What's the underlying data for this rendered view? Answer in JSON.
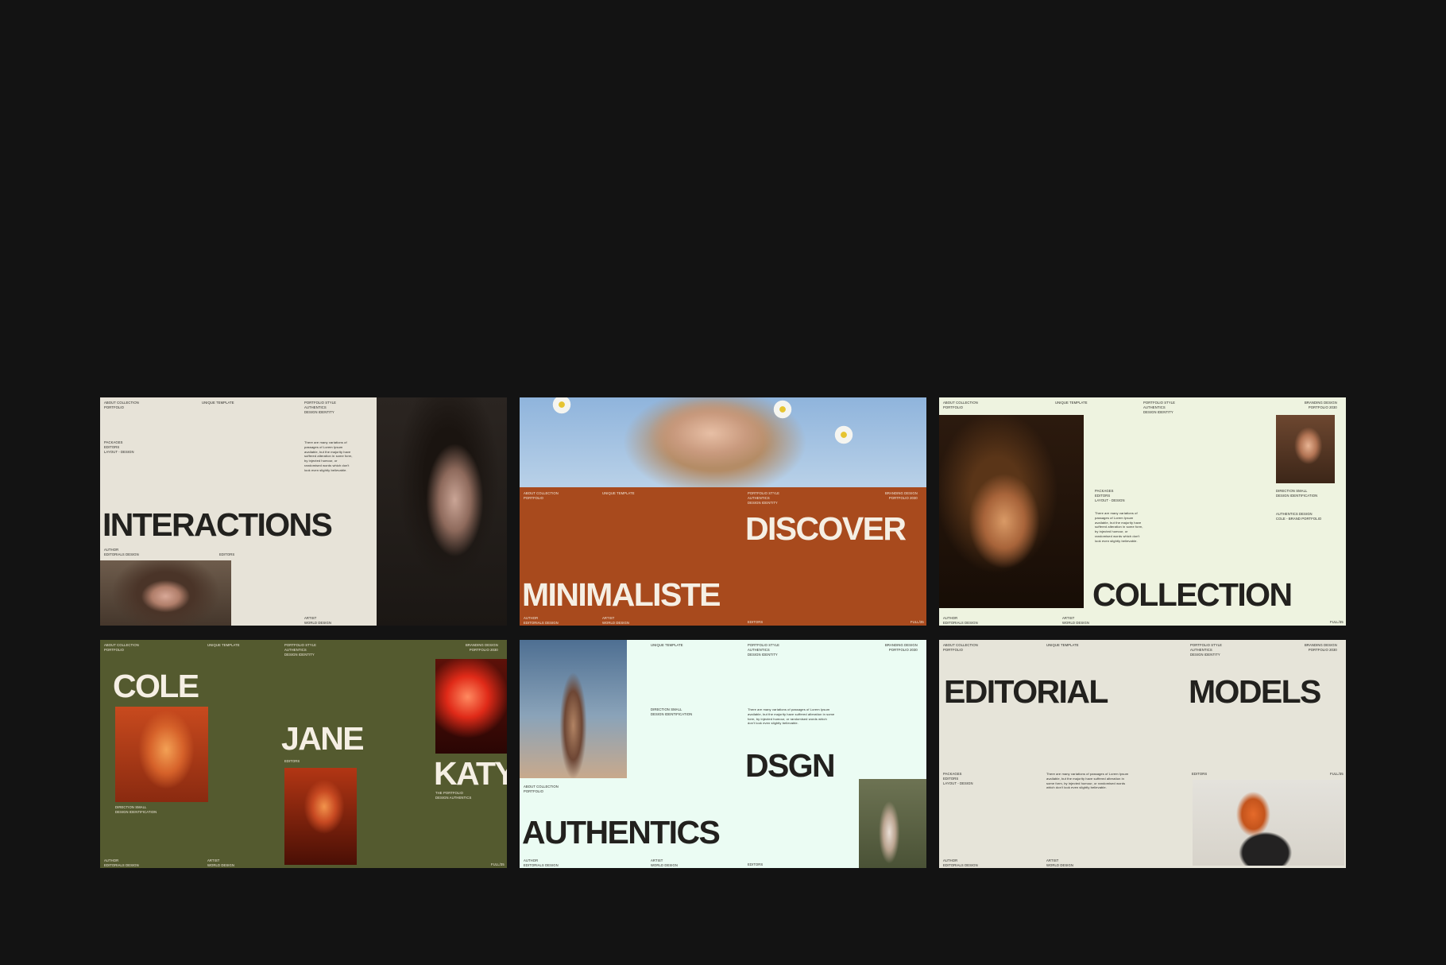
{
  "slides": [
    {
      "headline": "INTERACTIONS",
      "top": [
        "ABOUT COLLECTION\nPORTFOLIO",
        "UNIQUE TEMPLATE",
        "PORTFOLIO STYLE\nAUTHENTICS\nDESIGN IDENTITY"
      ],
      "side": "PACKAGES\nEDITORS\nLAYOUT - DESIGN",
      "paragraph": "There are many variations of passages of Lorem Ipsum available, but the majority have suffered alteration in some form, by injected humour, or randomised words which don't look even slightly believable.",
      "bottom": [
        "AUTHOR\nEDITORIALS DESIGN",
        "EDITORS",
        "ARTIST\nWORLD DESIGN"
      ]
    },
    {
      "headline_1": "DISCOVER",
      "headline_2": "MINIMALISTE",
      "top": [
        "ABOUT COLLECTION\nPORTFOLIO",
        "UNIQUE TEMPLATE",
        "PORTFOLIO STYLE\nAUTHENTICS\nDESIGN IDENTITY",
        "BRANDING DESIGN\nPORTFOLIO 2030"
      ],
      "bottom": [
        "AUTHOR\nEDITORIALS DESIGN",
        "ARTIST\nWORLD DESIGN",
        "EDITORS",
        "FULL/35"
      ]
    },
    {
      "headline": "COLLECTION",
      "top": [
        "ABOUT COLLECTION\nPORTFOLIO",
        "UNIQUE TEMPLATE",
        "PORTFOLIO STYLE\nAUTHENTICS\nDESIGN IDENTITY",
        "BRANDING DESIGN\nPORTFOLIO 2030"
      ],
      "side": "PACKAGES\nEDITORS\nLAYOUT - DESIGN",
      "paragraph": "There are many variations of passages of Lorem Ipsum available, but the majority have suffered alteration in some form, by injected humour, or randomised words which don't look even slightly believable.",
      "right_1": "DIRECTION SMALL\nDESIGN IDENTIFICATION",
      "right_2": "AUTHENTICS DESIGN\nCOLE - BRAND PORTFOLIO",
      "bottom": [
        "AUTHOR\nEDITORIALS DESIGN",
        "ARTIST\nWORLD DESIGN",
        "FULL/35"
      ]
    },
    {
      "headline_1": "COLE",
      "headline_2": "JANE",
      "headline_3": "KATY",
      "top": [
        "ABOUT COLLECTION\nPORTFOLIO",
        "UNIQUE TEMPLATE",
        "PORTFOLIO STYLE\nAUTHENTICS\nDESIGN IDENTITY",
        "BRANDING DESIGN\nPORTFOLIO 2030"
      ],
      "caption_1": "DIRECTION SMALL\nDESIGN IDENTIFICATION",
      "caption_2": "EDITORS",
      "caption_3": "THE PORTFOLIO\nDESIGN AUTHENTICS",
      "bottom": [
        "AUTHOR\nEDITORIALS DESIGN",
        "ARTIST\nWORLD DESIGN",
        "FULL/35"
      ]
    },
    {
      "headline_1": "DSGN",
      "headline_2": "AUTHENTICS",
      "top": [
        "UNIQUE TEMPLATE",
        "PORTFOLIO STYLE\nAUTHENTICS\nDESIGN IDENTITY",
        "BRANDING DESIGN\nPORTFOLIO 2030"
      ],
      "caption_1": "DIRECTION SMALL\nDESIGN IDENTIFICATION",
      "paragraph": "There are many variations of passages of Lorem Ipsum available, but the majority have suffered alteration in some form, by injected humour, or randomised words which don't look even slightly believable.",
      "caption_2": "ABOUT COLLECTION\nPORTFOLIO",
      "bottom": [
        "AUTHOR\nEDITORIALS DESIGN",
        "ARTIST\nWORLD DESIGN",
        "EDITORS"
      ]
    },
    {
      "headline_1": "EDITORIAL",
      "headline_2": "MODELS",
      "top": [
        "ABOUT COLLECTION\nPORTFOLIO",
        "UNIQUE TEMPLATE",
        "PORTFOLIO STYLE\nAUTHENTICS\nDESIGN IDENTITY",
        "BRANDING DESIGN\nPORTFOLIO 2030"
      ],
      "side": "PACKAGES\nEDITORS\nLAYOUT - DESIGN",
      "paragraph": "There are many variations of passages of Lorem Ipsum available, but the majority have suffered alteration in some form, by injected humour, or randomised words which don't look even slightly believable.",
      "caption_1": "EDITORS",
      "caption_2": "FULL/35",
      "bottom": [
        "AUTHOR\nEDITORIALS DESIGN",
        "ARTIST\nWORLD DESIGN"
      ]
    }
  ]
}
